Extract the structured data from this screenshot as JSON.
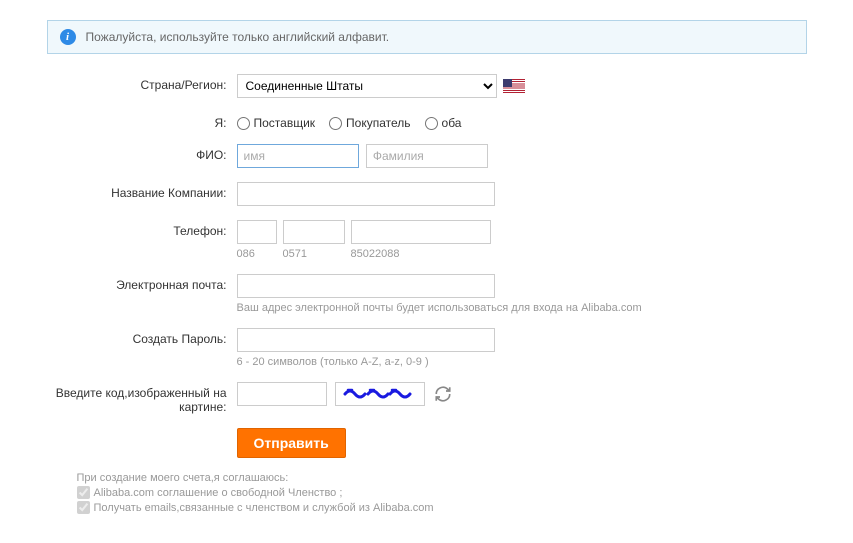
{
  "notice": "Пожалуйста, используйте только английский алфавит.",
  "labels": {
    "country": "Страна/Регион:",
    "iam": "Я:",
    "fio": "ФИО:",
    "company": "Название Компании:",
    "phone": "Телефон:",
    "email": "Электронная почта:",
    "password": "Создать Пароль:",
    "captcha": "Введите код,изображенный на картине:"
  },
  "country_selected": "Соединенные Штаты",
  "roles": {
    "supplier": "Поставщик",
    "buyer": "Покупатель",
    "both": "оба"
  },
  "placeholders": {
    "firstname": "имя",
    "lastname": "Фамилия"
  },
  "phone_hints": {
    "h1": "086",
    "h2": "0571",
    "h3": "85022088"
  },
  "email_help": "Ваш адрес электронной почты будет использоваться для входа на Alibaba.com",
  "password_help": "6 - 20 символов (только A-Z, a-z, 0-9 )",
  "submit": "Отправить",
  "terms": {
    "intro": "При создание моего счета,я соглашаюсь:",
    "line1": "Alibaba.com соглашение о свободной Членство ;",
    "line2": "Получать emails,связанные с членством и службой из Alibaba.com"
  }
}
